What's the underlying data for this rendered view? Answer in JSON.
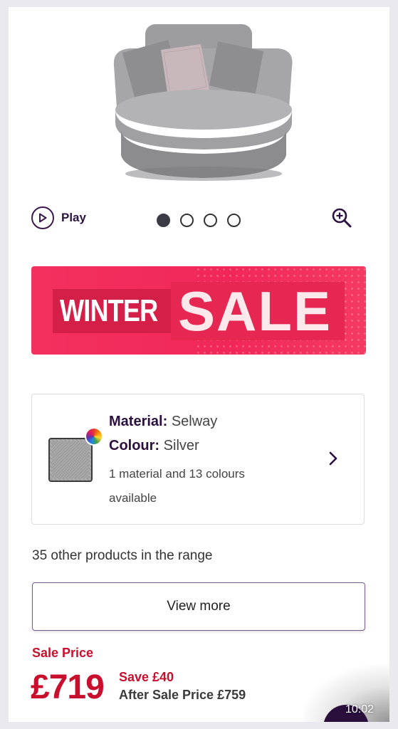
{
  "carousel": {
    "play_label": "Play",
    "slide_count": 4,
    "active_slide": 1
  },
  "banner": {
    "word1": "WINTER",
    "word2": "SALE"
  },
  "material": {
    "material_label": "Material:",
    "material_value": "Selway",
    "colour_label": "Colour:",
    "colour_value": "Silver",
    "options_text": "1 material and 13 colours available"
  },
  "range": {
    "text": "35 other products in the range",
    "view_more_label": "View more"
  },
  "pricing": {
    "sale_label": "Sale Price",
    "price": "£719",
    "save_text": "Save £40",
    "after_text": "After Sale Price £759"
  },
  "status_bar": {
    "time": "10:02"
  },
  "colors": {
    "accent_red": "#c8102e",
    "banner_pink": "#f0285a",
    "brand_purple": "#2b0f3f"
  }
}
